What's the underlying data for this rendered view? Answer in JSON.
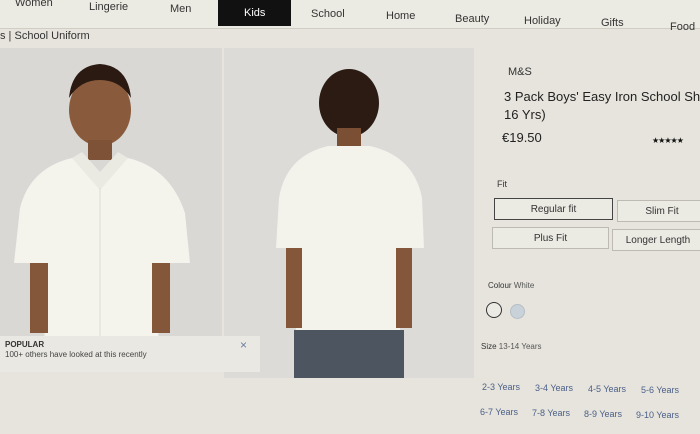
{
  "nav": {
    "items": [
      "Women",
      "Lingerie",
      "Men",
      "Kids",
      "School",
      "Home",
      "Beauty",
      "Holiday",
      "Gifts",
      "Food"
    ],
    "active": "Kids"
  },
  "breadcrumb": {
    "prefix": "s",
    "current": "School Uniform"
  },
  "popular": {
    "title": "POPULAR",
    "text": "100+ others have looked at this recently",
    "close": "×"
  },
  "product": {
    "brand": "M&S",
    "title_line1": "3 Pack Boys' Easy Iron School Sh",
    "title_line2": "16 Yrs)",
    "price": "€19.50",
    "rating_stars": "★★★★★"
  },
  "fit": {
    "label": "Fit",
    "options": [
      "Regular fit",
      "Slim Fit",
      "Plus Fit",
      "Longer Length"
    ],
    "selected": "Regular fit"
  },
  "colour": {
    "label": "Colour",
    "value": "White",
    "swatches": [
      {
        "name": "White",
        "color": "#eceae4",
        "selected": true
      },
      {
        "name": "Blue",
        "color": "#c9d2d9",
        "selected": false
      }
    ]
  },
  "size": {
    "label": "Size",
    "value": "13-14 Years",
    "options": [
      "2-3 Years",
      "3-4 Years",
      "4-5 Years",
      "5-6 Years",
      "6-7 Years",
      "7-8 Years",
      "8-9 Years",
      "9-10 Years"
    ]
  }
}
